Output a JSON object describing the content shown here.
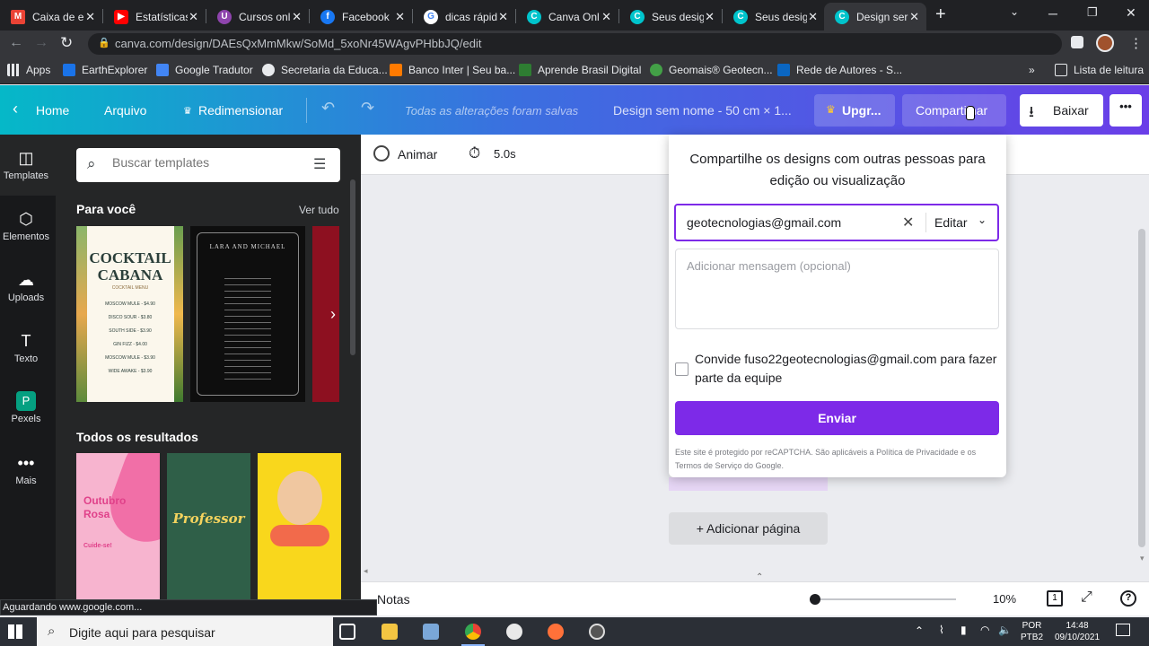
{
  "browser": {
    "tabs": [
      {
        "title": "Caixa de e",
        "icon": "gmail-icon",
        "color": "#ea4335"
      },
      {
        "title": "Estatísticas",
        "icon": "youtube-icon",
        "color": "#ff0000"
      },
      {
        "title": "Cursos onl",
        "icon": "courses-icon",
        "color": "#8e44ad"
      },
      {
        "title": "Facebook",
        "icon": "facebook-icon",
        "color": "#1877f2"
      },
      {
        "title": "dicas rápid",
        "icon": "google-icon",
        "color": "#ffffff"
      },
      {
        "title": "Canva Onl",
        "icon": "canva-icon",
        "color": "#00c4cc"
      },
      {
        "title": "Seus desig",
        "icon": "canva-icon",
        "color": "#00c4cc"
      },
      {
        "title": "Seus desig",
        "icon": "canva-icon",
        "color": "#00c4cc"
      },
      {
        "title": "Design ser",
        "icon": "canva-icon",
        "color": "#00c4cc"
      }
    ],
    "url": "canva.com/design/DAEsQxMmMkw/SoMd_5xoNr45WAgvPHbbJQ/edit",
    "bookmarks": [
      {
        "label": "Apps",
        "icon": "apps-icon"
      },
      {
        "label": "EarthExplorer",
        "icon": "earthexplorer-icon"
      },
      {
        "label": "Google Tradutor",
        "icon": "translate-icon"
      },
      {
        "label": "Secretaria da Educa...",
        "icon": "globe-icon"
      },
      {
        "label": "Banco Inter | Seu ba...",
        "icon": "bank-icon"
      },
      {
        "label": "Aprende Brasil Digital",
        "icon": "book-icon"
      },
      {
        "label": "Geomais® Geotecn...",
        "icon": "geomais-icon"
      },
      {
        "label": "Rede de Autores - S...",
        "icon": "linkedin-icon"
      }
    ],
    "reading_list": "Lista de leitura",
    "status": "Aguardando www.google.com..."
  },
  "header": {
    "home": "Home",
    "file": "Arquivo",
    "resize": "Redimensionar",
    "saved": "Todas as alterações foram salvas",
    "design_name": "Design sem nome - 50 cm × 1...",
    "upgrade": "Upgr...",
    "share": "Compartilhar",
    "download": "Baixar"
  },
  "rail": [
    "Templates",
    "Elementos",
    "Uploads",
    "Texto",
    "Pexels",
    "Mais"
  ],
  "panel": {
    "search_placeholder": "Buscar templates",
    "for_you": "Para você",
    "see_all": "Ver tudo",
    "all_results": "Todos os resultados",
    "cocktail_title": "COCKTAIL CABANA",
    "cocktail_sub": "COCKTAIL MENU",
    "cocktail_items": [
      "MOSCOW MULE - $4.90",
      "DISCO SOUR - $3.80",
      "SOUTH SIDE - $3.90",
      "GIN FIZZ - $4.00",
      "MOSCOW MULE - $3.90",
      "WIDE AWAKE - $3.90"
    ],
    "lara_title": "LARA AND MICHAEL",
    "outubro": "Outubro Rosa",
    "outubro_cta": "Cuide-se!",
    "professor": "Professor"
  },
  "subbar": {
    "animate": "Animar",
    "duration": "5.0s"
  },
  "stage": {
    "add_page": "+ Adicionar página"
  },
  "footer": {
    "notes": "Notas",
    "zoom": "10%",
    "page": "1"
  },
  "share": {
    "title": "Compartilhe os designs com outras pessoas para edição ou visualização",
    "email_value": "geotecnologias@gmail.com",
    "permission": "Editar",
    "message_placeholder": "Adicionar mensagem (opcional)",
    "invite_text": "Convide fuso22geotecnologias@gmail.com para fazer parte da equipe",
    "send": "Enviar",
    "recaptcha": "Este site é protegido por reCAPTCHA. São aplicáveis a Política de Privacidade e os Termos de Serviço do Google."
  },
  "taskbar": {
    "search_placeholder": "Digite aqui para pesquisar",
    "lang": "POR",
    "layout": "PTB2",
    "time": "14:48",
    "date": "09/10/2021"
  },
  "colors": {
    "accent": "#7d2ae8",
    "header_start": "#05b8c8",
    "header_end": "#6a3ee8"
  }
}
